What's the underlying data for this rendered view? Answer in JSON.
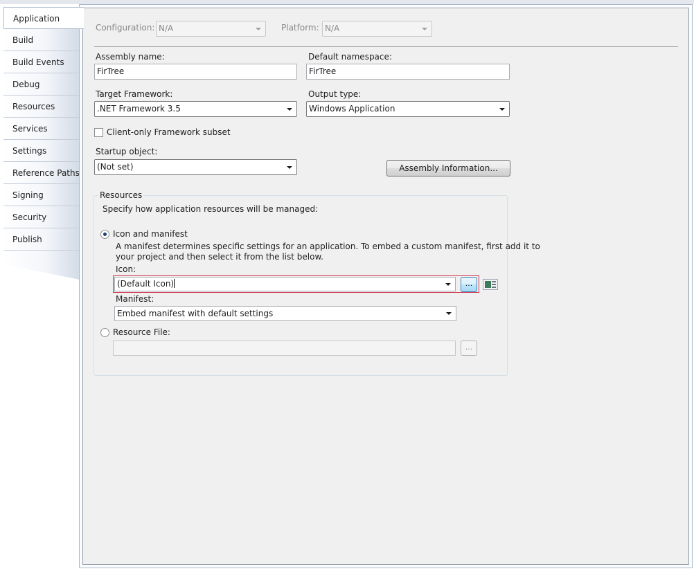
{
  "tabs": [
    {
      "label": "Application",
      "active": true
    },
    {
      "label": "Build"
    },
    {
      "label": "Build Events"
    },
    {
      "label": "Debug"
    },
    {
      "label": "Resources"
    },
    {
      "label": "Services"
    },
    {
      "label": "Settings"
    },
    {
      "label": "Reference Paths"
    },
    {
      "label": "Signing"
    },
    {
      "label": "Security"
    },
    {
      "label": "Publish"
    }
  ],
  "toolbar": {
    "configuration_label": "Configuration:",
    "configuration_value": "N/A",
    "platform_label": "Platform:",
    "platform_value": "N/A"
  },
  "assembly": {
    "name_label": "Assembly name:",
    "name_value": "FirTree",
    "namespace_label": "Default namespace:",
    "namespace_value": "FirTree"
  },
  "framework": {
    "target_label": "Target Framework:",
    "target_value": ".NET Framework 3.5",
    "output_label": "Output type:",
    "output_value": "Windows Application",
    "client_only_label": "Client-only Framework subset"
  },
  "startup": {
    "label": "Startup object:",
    "value": "(Not set)",
    "assembly_info_button": "Assembly Information..."
  },
  "resources": {
    "group_title": "Resources",
    "description": "Specify how application resources will be managed:",
    "icon_manifest_label": "Icon and manifest",
    "manifest_help_line1": "A manifest determines specific settings for an application. To embed a custom manifest, first add it to",
    "manifest_help_line2": "your project and then select it from the list below.",
    "icon_label": "Icon:",
    "icon_value": "(Default Icon)",
    "browse_label": "...",
    "manifest_label": "Manifest:",
    "manifest_value": "Embed manifest with default settings",
    "resource_file_label": "Resource File:",
    "resource_file_value": "",
    "resource_browse_label": "..."
  }
}
